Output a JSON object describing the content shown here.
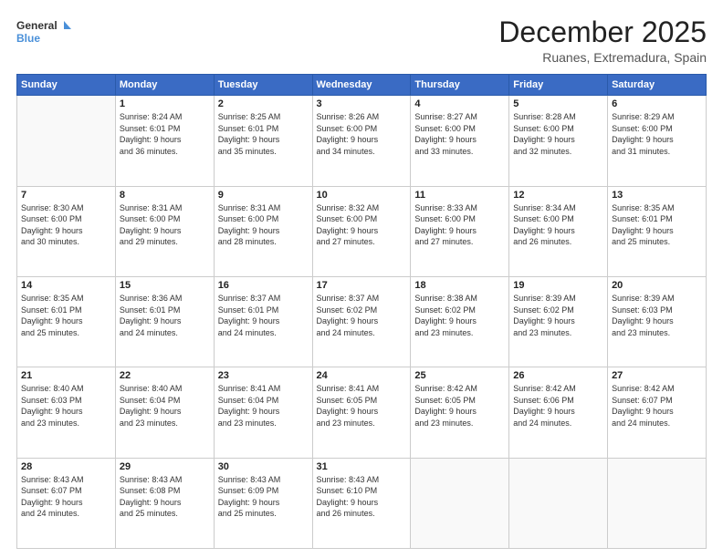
{
  "header": {
    "logo": {
      "line1": "General",
      "line2": "Blue"
    },
    "title": "December 2025",
    "location": "Ruanes, Extremadura, Spain"
  },
  "weekdays": [
    "Sunday",
    "Monday",
    "Tuesday",
    "Wednesday",
    "Thursday",
    "Friday",
    "Saturday"
  ],
  "weeks": [
    [
      {
        "day": "",
        "info": ""
      },
      {
        "day": "1",
        "info": "Sunrise: 8:24 AM\nSunset: 6:01 PM\nDaylight: 9 hours\nand 36 minutes."
      },
      {
        "day": "2",
        "info": "Sunrise: 8:25 AM\nSunset: 6:01 PM\nDaylight: 9 hours\nand 35 minutes."
      },
      {
        "day": "3",
        "info": "Sunrise: 8:26 AM\nSunset: 6:00 PM\nDaylight: 9 hours\nand 34 minutes."
      },
      {
        "day": "4",
        "info": "Sunrise: 8:27 AM\nSunset: 6:00 PM\nDaylight: 9 hours\nand 33 minutes."
      },
      {
        "day": "5",
        "info": "Sunrise: 8:28 AM\nSunset: 6:00 PM\nDaylight: 9 hours\nand 32 minutes."
      },
      {
        "day": "6",
        "info": "Sunrise: 8:29 AM\nSunset: 6:00 PM\nDaylight: 9 hours\nand 31 minutes."
      }
    ],
    [
      {
        "day": "7",
        "info": "Sunrise: 8:30 AM\nSunset: 6:00 PM\nDaylight: 9 hours\nand 30 minutes."
      },
      {
        "day": "8",
        "info": "Sunrise: 8:31 AM\nSunset: 6:00 PM\nDaylight: 9 hours\nand 29 minutes."
      },
      {
        "day": "9",
        "info": "Sunrise: 8:31 AM\nSunset: 6:00 PM\nDaylight: 9 hours\nand 28 minutes."
      },
      {
        "day": "10",
        "info": "Sunrise: 8:32 AM\nSunset: 6:00 PM\nDaylight: 9 hours\nand 27 minutes."
      },
      {
        "day": "11",
        "info": "Sunrise: 8:33 AM\nSunset: 6:00 PM\nDaylight: 9 hours\nand 27 minutes."
      },
      {
        "day": "12",
        "info": "Sunrise: 8:34 AM\nSunset: 6:00 PM\nDaylight: 9 hours\nand 26 minutes."
      },
      {
        "day": "13",
        "info": "Sunrise: 8:35 AM\nSunset: 6:01 PM\nDaylight: 9 hours\nand 25 minutes."
      }
    ],
    [
      {
        "day": "14",
        "info": "Sunrise: 8:35 AM\nSunset: 6:01 PM\nDaylight: 9 hours\nand 25 minutes."
      },
      {
        "day": "15",
        "info": "Sunrise: 8:36 AM\nSunset: 6:01 PM\nDaylight: 9 hours\nand 24 minutes."
      },
      {
        "day": "16",
        "info": "Sunrise: 8:37 AM\nSunset: 6:01 PM\nDaylight: 9 hours\nand 24 minutes."
      },
      {
        "day": "17",
        "info": "Sunrise: 8:37 AM\nSunset: 6:02 PM\nDaylight: 9 hours\nand 24 minutes."
      },
      {
        "day": "18",
        "info": "Sunrise: 8:38 AM\nSunset: 6:02 PM\nDaylight: 9 hours\nand 23 minutes."
      },
      {
        "day": "19",
        "info": "Sunrise: 8:39 AM\nSunset: 6:02 PM\nDaylight: 9 hours\nand 23 minutes."
      },
      {
        "day": "20",
        "info": "Sunrise: 8:39 AM\nSunset: 6:03 PM\nDaylight: 9 hours\nand 23 minutes."
      }
    ],
    [
      {
        "day": "21",
        "info": "Sunrise: 8:40 AM\nSunset: 6:03 PM\nDaylight: 9 hours\nand 23 minutes."
      },
      {
        "day": "22",
        "info": "Sunrise: 8:40 AM\nSunset: 6:04 PM\nDaylight: 9 hours\nand 23 minutes."
      },
      {
        "day": "23",
        "info": "Sunrise: 8:41 AM\nSunset: 6:04 PM\nDaylight: 9 hours\nand 23 minutes."
      },
      {
        "day": "24",
        "info": "Sunrise: 8:41 AM\nSunset: 6:05 PM\nDaylight: 9 hours\nand 23 minutes."
      },
      {
        "day": "25",
        "info": "Sunrise: 8:42 AM\nSunset: 6:05 PM\nDaylight: 9 hours\nand 23 minutes."
      },
      {
        "day": "26",
        "info": "Sunrise: 8:42 AM\nSunset: 6:06 PM\nDaylight: 9 hours\nand 24 minutes."
      },
      {
        "day": "27",
        "info": "Sunrise: 8:42 AM\nSunset: 6:07 PM\nDaylight: 9 hours\nand 24 minutes."
      }
    ],
    [
      {
        "day": "28",
        "info": "Sunrise: 8:43 AM\nSunset: 6:07 PM\nDaylight: 9 hours\nand 24 minutes."
      },
      {
        "day": "29",
        "info": "Sunrise: 8:43 AM\nSunset: 6:08 PM\nDaylight: 9 hours\nand 25 minutes."
      },
      {
        "day": "30",
        "info": "Sunrise: 8:43 AM\nSunset: 6:09 PM\nDaylight: 9 hours\nand 25 minutes."
      },
      {
        "day": "31",
        "info": "Sunrise: 8:43 AM\nSunset: 6:10 PM\nDaylight: 9 hours\nand 26 minutes."
      },
      {
        "day": "",
        "info": ""
      },
      {
        "day": "",
        "info": ""
      },
      {
        "day": "",
        "info": ""
      }
    ]
  ]
}
